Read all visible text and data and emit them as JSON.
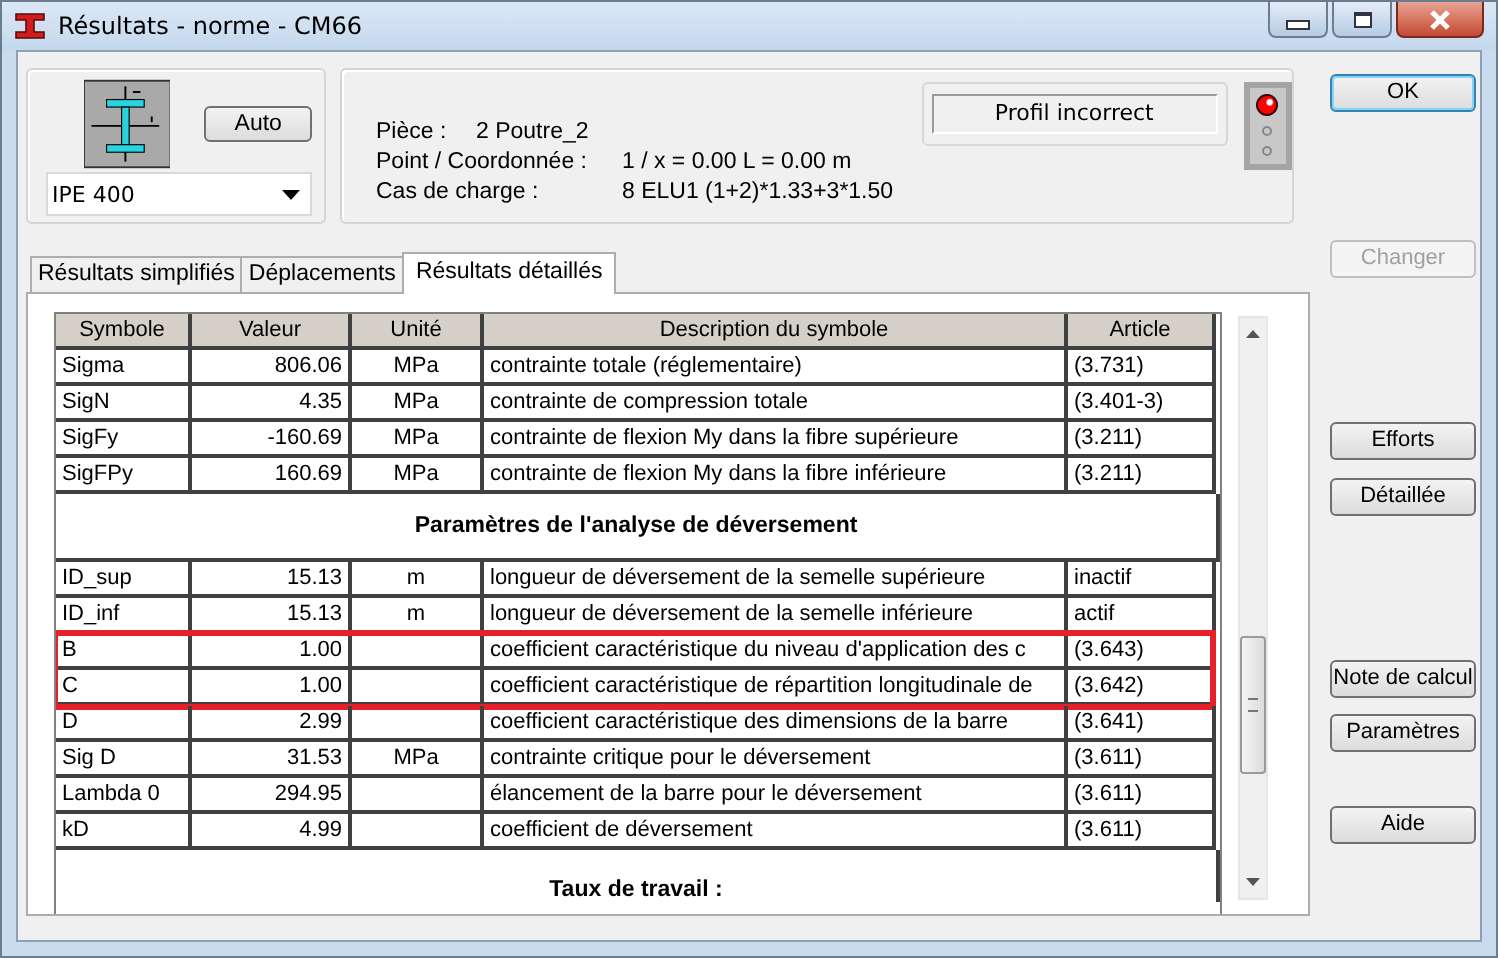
{
  "window": {
    "title": "Résultats - norme - CM66"
  },
  "profile": {
    "auto_button": "Auto",
    "section": "IPE 400"
  },
  "info": [
    {
      "label": "Pièce :",
      "value": "2  Poutre_2"
    },
    {
      "label": "Point / Coordonnée :",
      "value": "1 / x = 0.00 L = 0.00 m"
    },
    {
      "label": "Cas de charge :",
      "value": "8 ELU1  (1+2)*1.33+3*1.50"
    }
  ],
  "status": "Profil incorrect",
  "lights": [
    {
      "on": true
    },
    {
      "on": false
    },
    {
      "on": false
    }
  ],
  "tabs": [
    {
      "label": "Résultats simplifiés",
      "selected": false
    },
    {
      "label": "Déplacements",
      "selected": false
    },
    {
      "label": "Résultats détaillés",
      "selected": true
    }
  ],
  "table": {
    "columns": [
      "Symbole",
      "Valeur",
      "Unité",
      "Description du symbole",
      "Article"
    ],
    "rows": [
      {
        "kind": "data",
        "cells": [
          "Sigma",
          "806.06",
          "MPa",
          "contrainte totale (réglementaire)",
          "(3.731)"
        ],
        "highlighted": false
      },
      {
        "kind": "data",
        "cells": [
          "SigN",
          "4.35",
          "MPa",
          "contrainte de compression totale",
          "(3.401-3)"
        ],
        "highlighted": false
      },
      {
        "kind": "data",
        "cells": [
          "SigFy",
          "-160.69",
          "MPa",
          "contrainte de flexion My dans la fibre supérieure",
          "(3.211)"
        ],
        "highlighted": false
      },
      {
        "kind": "data",
        "cells": [
          "SigFPy",
          "160.69",
          "MPa",
          "contrainte de flexion My dans la fibre inférieure",
          "(3.211)"
        ],
        "highlighted": false
      },
      {
        "kind": "section",
        "title": "Paramètres de l'analyse de déversement"
      },
      {
        "kind": "data",
        "cells": [
          "ID_sup",
          "15.13",
          "m",
          "longueur de déversement de la semelle supérieure",
          "inactif"
        ],
        "highlighted": false
      },
      {
        "kind": "data",
        "cells": [
          "ID_inf",
          "15.13",
          "m",
          "longueur de déversement de la semelle inférieure",
          "actif"
        ],
        "highlighted": false
      },
      {
        "kind": "data",
        "cells": [
          "B",
          "1.00",
          "",
          "coefficient caractéristique du niveau d'application des c",
          "(3.643)"
        ],
        "highlighted": true
      },
      {
        "kind": "data",
        "cells": [
          "C",
          "1.00",
          "",
          "coefficient caractéristique de répartition longitudinale de",
          "(3.642)"
        ],
        "highlighted": true
      },
      {
        "kind": "data",
        "cells": [
          "D",
          "2.99",
          "",
          "coefficient caractéristique des dimensions de la barre",
          "(3.641)"
        ],
        "highlighted": false
      },
      {
        "kind": "data",
        "cells": [
          "Sig D",
          "31.53",
          "MPa",
          "contrainte critique pour le déversement",
          "(3.611)"
        ],
        "highlighted": false
      },
      {
        "kind": "data",
        "cells": [
          "Lambda 0",
          "294.95",
          "",
          "élancement de la barre pour le déversement",
          "(3.611)"
        ],
        "highlighted": false
      },
      {
        "kind": "data",
        "cells": [
          "kD",
          "4.99",
          "",
          "coefficient de déversement",
          "(3.611)"
        ],
        "highlighted": false
      },
      {
        "kind": "section",
        "title": "Taux de travail :"
      }
    ]
  },
  "buttons": [
    {
      "label": "OK",
      "disabled": false,
      "default": true
    },
    {
      "label": "Changer",
      "disabled": true,
      "default": false
    },
    {
      "label": "Efforts",
      "disabled": false,
      "default": false
    },
    {
      "label": "Détaillée",
      "disabled": false,
      "default": false
    },
    {
      "label": "Note de calcul",
      "disabled": false,
      "default": false
    },
    {
      "label": "Paramètres",
      "disabled": false,
      "default": false
    },
    {
      "label": "Aide",
      "disabled": false,
      "default": false
    }
  ]
}
